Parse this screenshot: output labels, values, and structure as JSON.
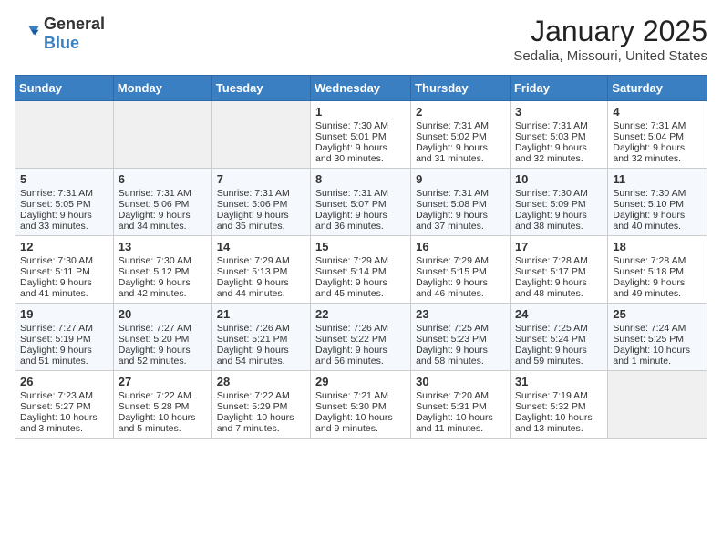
{
  "header": {
    "logo_general": "General",
    "logo_blue": "Blue",
    "month": "January 2025",
    "location": "Sedalia, Missouri, United States"
  },
  "weekdays": [
    "Sunday",
    "Monday",
    "Tuesday",
    "Wednesday",
    "Thursday",
    "Friday",
    "Saturday"
  ],
  "weeks": [
    [
      {
        "day": "",
        "empty": true
      },
      {
        "day": "",
        "empty": true
      },
      {
        "day": "",
        "empty": true
      },
      {
        "day": "1",
        "sunrise": "Sunrise: 7:30 AM",
        "sunset": "Sunset: 5:01 PM",
        "daylight": "Daylight: 9 hours and 30 minutes."
      },
      {
        "day": "2",
        "sunrise": "Sunrise: 7:31 AM",
        "sunset": "Sunset: 5:02 PM",
        "daylight": "Daylight: 9 hours and 31 minutes."
      },
      {
        "day": "3",
        "sunrise": "Sunrise: 7:31 AM",
        "sunset": "Sunset: 5:03 PM",
        "daylight": "Daylight: 9 hours and 32 minutes."
      },
      {
        "day": "4",
        "sunrise": "Sunrise: 7:31 AM",
        "sunset": "Sunset: 5:04 PM",
        "daylight": "Daylight: 9 hours and 32 minutes."
      }
    ],
    [
      {
        "day": "5",
        "sunrise": "Sunrise: 7:31 AM",
        "sunset": "Sunset: 5:05 PM",
        "daylight": "Daylight: 9 hours and 33 minutes."
      },
      {
        "day": "6",
        "sunrise": "Sunrise: 7:31 AM",
        "sunset": "Sunset: 5:06 PM",
        "daylight": "Daylight: 9 hours and 34 minutes."
      },
      {
        "day": "7",
        "sunrise": "Sunrise: 7:31 AM",
        "sunset": "Sunset: 5:06 PM",
        "daylight": "Daylight: 9 hours and 35 minutes."
      },
      {
        "day": "8",
        "sunrise": "Sunrise: 7:31 AM",
        "sunset": "Sunset: 5:07 PM",
        "daylight": "Daylight: 9 hours and 36 minutes."
      },
      {
        "day": "9",
        "sunrise": "Sunrise: 7:31 AM",
        "sunset": "Sunset: 5:08 PM",
        "daylight": "Daylight: 9 hours and 37 minutes."
      },
      {
        "day": "10",
        "sunrise": "Sunrise: 7:30 AM",
        "sunset": "Sunset: 5:09 PM",
        "daylight": "Daylight: 9 hours and 38 minutes."
      },
      {
        "day": "11",
        "sunrise": "Sunrise: 7:30 AM",
        "sunset": "Sunset: 5:10 PM",
        "daylight": "Daylight: 9 hours and 40 minutes."
      }
    ],
    [
      {
        "day": "12",
        "sunrise": "Sunrise: 7:30 AM",
        "sunset": "Sunset: 5:11 PM",
        "daylight": "Daylight: 9 hours and 41 minutes."
      },
      {
        "day": "13",
        "sunrise": "Sunrise: 7:30 AM",
        "sunset": "Sunset: 5:12 PM",
        "daylight": "Daylight: 9 hours and 42 minutes."
      },
      {
        "day": "14",
        "sunrise": "Sunrise: 7:29 AM",
        "sunset": "Sunset: 5:13 PM",
        "daylight": "Daylight: 9 hours and 44 minutes."
      },
      {
        "day": "15",
        "sunrise": "Sunrise: 7:29 AM",
        "sunset": "Sunset: 5:14 PM",
        "daylight": "Daylight: 9 hours and 45 minutes."
      },
      {
        "day": "16",
        "sunrise": "Sunrise: 7:29 AM",
        "sunset": "Sunset: 5:15 PM",
        "daylight": "Daylight: 9 hours and 46 minutes."
      },
      {
        "day": "17",
        "sunrise": "Sunrise: 7:28 AM",
        "sunset": "Sunset: 5:17 PM",
        "daylight": "Daylight: 9 hours and 48 minutes."
      },
      {
        "day": "18",
        "sunrise": "Sunrise: 7:28 AM",
        "sunset": "Sunset: 5:18 PM",
        "daylight": "Daylight: 9 hours and 49 minutes."
      }
    ],
    [
      {
        "day": "19",
        "sunrise": "Sunrise: 7:27 AM",
        "sunset": "Sunset: 5:19 PM",
        "daylight": "Daylight: 9 hours and 51 minutes."
      },
      {
        "day": "20",
        "sunrise": "Sunrise: 7:27 AM",
        "sunset": "Sunset: 5:20 PM",
        "daylight": "Daylight: 9 hours and 52 minutes."
      },
      {
        "day": "21",
        "sunrise": "Sunrise: 7:26 AM",
        "sunset": "Sunset: 5:21 PM",
        "daylight": "Daylight: 9 hours and 54 minutes."
      },
      {
        "day": "22",
        "sunrise": "Sunrise: 7:26 AM",
        "sunset": "Sunset: 5:22 PM",
        "daylight": "Daylight: 9 hours and 56 minutes."
      },
      {
        "day": "23",
        "sunrise": "Sunrise: 7:25 AM",
        "sunset": "Sunset: 5:23 PM",
        "daylight": "Daylight: 9 hours and 58 minutes."
      },
      {
        "day": "24",
        "sunrise": "Sunrise: 7:25 AM",
        "sunset": "Sunset: 5:24 PM",
        "daylight": "Daylight: 9 hours and 59 minutes."
      },
      {
        "day": "25",
        "sunrise": "Sunrise: 7:24 AM",
        "sunset": "Sunset: 5:25 PM",
        "daylight": "Daylight: 10 hours and 1 minute."
      }
    ],
    [
      {
        "day": "26",
        "sunrise": "Sunrise: 7:23 AM",
        "sunset": "Sunset: 5:27 PM",
        "daylight": "Daylight: 10 hours and 3 minutes."
      },
      {
        "day": "27",
        "sunrise": "Sunrise: 7:22 AM",
        "sunset": "Sunset: 5:28 PM",
        "daylight": "Daylight: 10 hours and 5 minutes."
      },
      {
        "day": "28",
        "sunrise": "Sunrise: 7:22 AM",
        "sunset": "Sunset: 5:29 PM",
        "daylight": "Daylight: 10 hours and 7 minutes."
      },
      {
        "day": "29",
        "sunrise": "Sunrise: 7:21 AM",
        "sunset": "Sunset: 5:30 PM",
        "daylight": "Daylight: 10 hours and 9 minutes."
      },
      {
        "day": "30",
        "sunrise": "Sunrise: 7:20 AM",
        "sunset": "Sunset: 5:31 PM",
        "daylight": "Daylight: 10 hours and 11 minutes."
      },
      {
        "day": "31",
        "sunrise": "Sunrise: 7:19 AM",
        "sunset": "Sunset: 5:32 PM",
        "daylight": "Daylight: 10 hours and 13 minutes."
      },
      {
        "day": "",
        "empty": true
      }
    ]
  ]
}
